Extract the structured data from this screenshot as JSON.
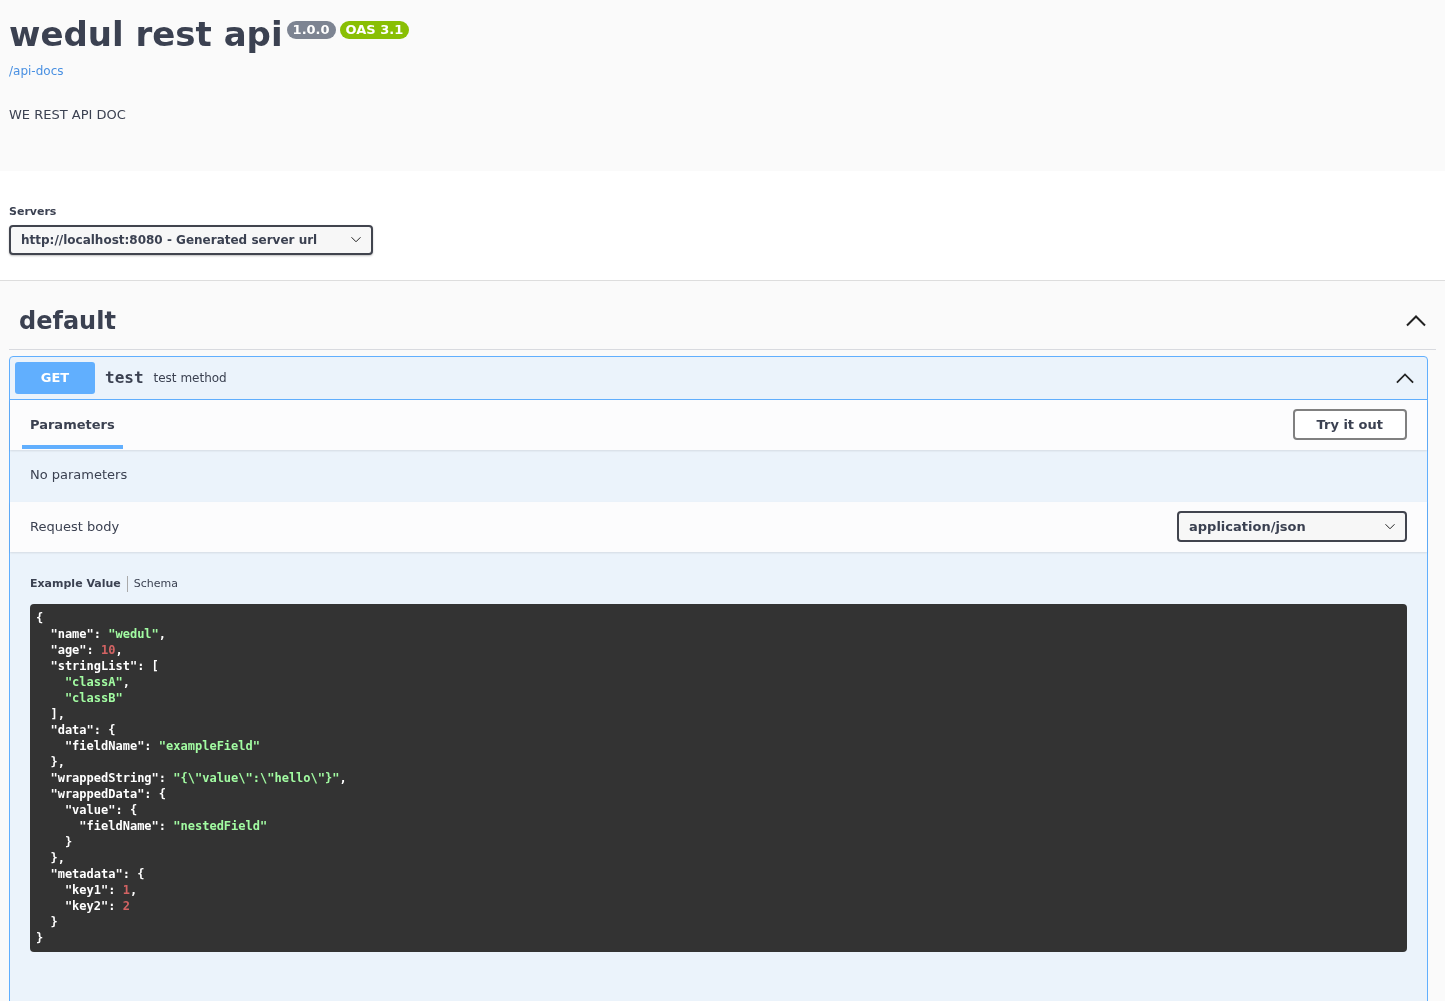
{
  "info": {
    "title": "wedul rest api",
    "version": "1.0.0",
    "oas": "OAS 3.1",
    "link": "/api-docs",
    "description": "WE REST API DOC"
  },
  "servers": {
    "label": "Servers",
    "value": "http://localhost:8080 - Generated server url"
  },
  "tag": {
    "name": "default",
    "expanded": true
  },
  "operation": {
    "method": "GET",
    "path": "test",
    "summary": "test method",
    "expanded": true,
    "tabs": [
      {
        "label": "Parameters",
        "selected": true
      }
    ],
    "try_button": "Try it out",
    "no_params": "No parameters",
    "request_body": {
      "label": "Request body",
      "content_type": "application/json"
    },
    "example_tabs": [
      {
        "label": "Example Value",
        "selected": true
      },
      {
        "label": "Schema",
        "selected": false
      }
    ],
    "code_lines": [
      [
        {
          "kind": "plain",
          "text": "{"
        }
      ],
      [
        {
          "kind": "plain",
          "text": "  \"name\": "
        },
        {
          "kind": "string",
          "text": "\"wedul\""
        },
        {
          "kind": "plain",
          "text": ","
        }
      ],
      [
        {
          "kind": "plain",
          "text": "  \"age\": "
        },
        {
          "kind": "number",
          "text": "10"
        },
        {
          "kind": "plain",
          "text": ","
        }
      ],
      [
        {
          "kind": "plain",
          "text": "  \"stringList\": ["
        }
      ],
      [
        {
          "kind": "string",
          "text": "    \"classA\""
        },
        {
          "kind": "plain",
          "text": ","
        }
      ],
      [
        {
          "kind": "string",
          "text": "    \"classB\""
        }
      ],
      [
        {
          "kind": "plain",
          "text": "  ],"
        }
      ],
      [
        {
          "kind": "plain",
          "text": "  \"data\": {"
        }
      ],
      [
        {
          "kind": "plain",
          "text": "    \"fieldName\": "
        },
        {
          "kind": "string",
          "text": "\"exampleField\""
        }
      ],
      [
        {
          "kind": "plain",
          "text": "  },"
        }
      ],
      [
        {
          "kind": "plain",
          "text": "  \"wrappedString\": "
        },
        {
          "kind": "string",
          "text": "\"{\\\"value\\\":\\\"hello\\\"}\""
        },
        {
          "kind": "plain",
          "text": ","
        }
      ],
      [
        {
          "kind": "plain",
          "text": "  \"wrappedData\": {"
        }
      ],
      [
        {
          "kind": "plain",
          "text": "    \"value\": {"
        }
      ],
      [
        {
          "kind": "plain",
          "text": "      \"fieldName\": "
        },
        {
          "kind": "string",
          "text": "\"nestedField\""
        }
      ],
      [
        {
          "kind": "plain",
          "text": "    }"
        }
      ],
      [
        {
          "kind": "plain",
          "text": "  },"
        }
      ],
      [
        {
          "kind": "plain",
          "text": "  \"metadata\": {"
        }
      ],
      [
        {
          "kind": "plain",
          "text": "    \"key1\": "
        },
        {
          "kind": "number",
          "text": "1"
        },
        {
          "kind": "plain",
          "text": ","
        }
      ],
      [
        {
          "kind": "plain",
          "text": "    \"key2\": "
        },
        {
          "kind": "number",
          "text": "2"
        }
      ],
      [
        {
          "kind": "plain",
          "text": "  }"
        }
      ],
      [
        {
          "kind": "plain",
          "text": "}"
        }
      ]
    ]
  }
}
